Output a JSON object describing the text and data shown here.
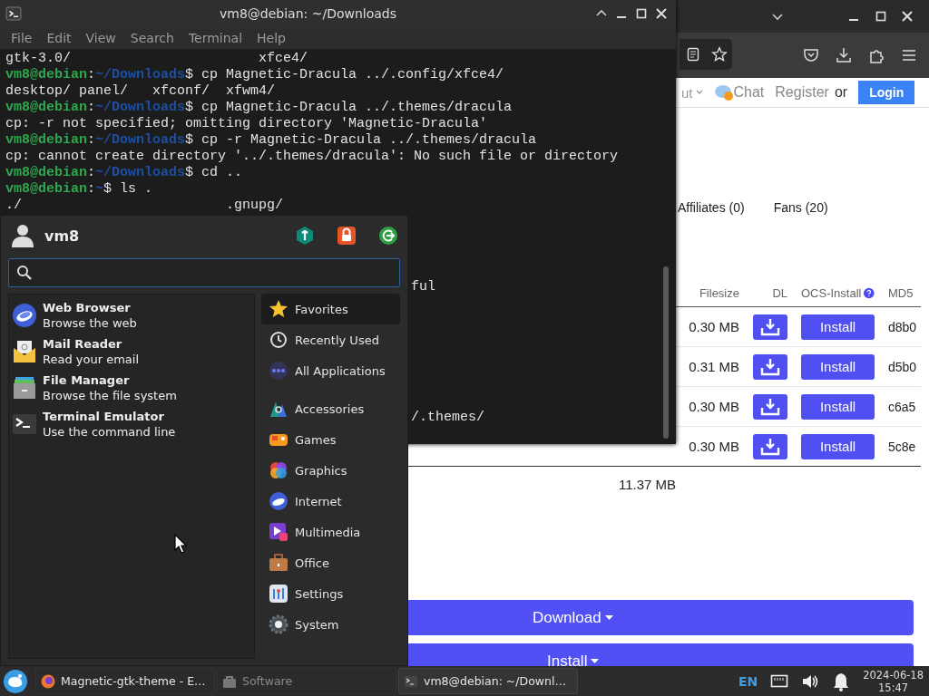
{
  "terminal": {
    "title": "vm8@debian: ~/Downloads",
    "menu": [
      "File",
      "Edit",
      "View",
      "Search",
      "Terminal",
      "Help"
    ],
    "lines": [
      {
        "kind": "output",
        "text": "gtk-3.0/                       xfce4/"
      },
      {
        "kind": "prompt",
        "user": "vm8@debian",
        "sep": ":",
        "path": "~/Downloads",
        "command": "$ cp Magnetic-Dracula ../.config/xfce4/"
      },
      {
        "kind": "output",
        "text": "desktop/ panel/   xfconf/  xfwm4/"
      },
      {
        "kind": "prompt",
        "user": "vm8@debian",
        "sep": ":",
        "path": "~/Downloads",
        "command": "$ cp Magnetic-Dracula ../.themes/dracula"
      },
      {
        "kind": "output",
        "text": "cp: -r not specified; omitting directory 'Magnetic-Dracula'"
      },
      {
        "kind": "prompt",
        "user": "vm8@debian",
        "sep": ":",
        "path": "~/Downloads",
        "command": "$ cp -r Magnetic-Dracula ../.themes/dracula"
      },
      {
        "kind": "output",
        "text": "cp: cannot create directory '../.themes/dracula': No such file or directory"
      },
      {
        "kind": "prompt",
        "user": "vm8@debian",
        "sep": ":",
        "path": "~/Downloads",
        "command": "$ cd .."
      },
      {
        "kind": "prompt",
        "user": "vm8@debian",
        "sep": ":",
        "path": "~",
        "command": "$ ls ."
      },
      {
        "kind": "output",
        "text": "./                         .gnupg/"
      },
      {
        "kind": "fragment",
        "text": "ful"
      },
      {
        "kind": "fragment",
        "text": "/.themes/"
      }
    ]
  },
  "browser": {
    "nav": [
      {
        "kind": "dropdown",
        "label": "ut"
      },
      {
        "kind": "chat",
        "label": "Chat"
      },
      {
        "kind": "link",
        "label": "Register"
      },
      {
        "kind": "text",
        "label": "or"
      },
      {
        "kind": "button",
        "label": "Login"
      }
    ],
    "tabs": [
      "Affiliates (0)",
      "Fans (20)"
    ],
    "table": {
      "columns": [
        "Filesize",
        "DL",
        "OCS-Install",
        "MD5"
      ],
      "rows": [
        {
          "filesize": "0.30 MB",
          "install": "Install",
          "md5": "d8b0"
        },
        {
          "filesize": "0.31 MB",
          "install": "Install",
          "md5": "d5b0"
        },
        {
          "filesize": "0.30 MB",
          "install": "Install",
          "md5": "c6a5"
        },
        {
          "filesize": "0.30 MB",
          "install": "Install",
          "md5": "5c8e"
        }
      ],
      "total": "11.37 MB"
    },
    "actions": [
      "Download",
      "Install"
    ]
  },
  "menu": {
    "user": "vm8",
    "favorites": [
      {
        "name": "Web Browser",
        "description": "Browse the web"
      },
      {
        "name": "Mail Reader",
        "description": "Read your email"
      },
      {
        "name": "File Manager",
        "description": "Browse the file system"
      },
      {
        "name": "Terminal Emulator",
        "description": "Use the command line"
      }
    ],
    "views": [
      {
        "label": "Favorites",
        "selected": true
      },
      {
        "label": "Recently Used",
        "selected": false
      },
      {
        "label": "All Applications",
        "selected": false
      }
    ],
    "categories": [
      {
        "label": "Accessories",
        "selected": false
      },
      {
        "label": "Games",
        "selected": false
      },
      {
        "label": "Graphics",
        "selected": false
      },
      {
        "label": "Internet",
        "selected": false
      },
      {
        "label": "Multimedia",
        "selected": false
      },
      {
        "label": "Office",
        "selected": false
      },
      {
        "label": "Settings",
        "selected": false
      },
      {
        "label": "System",
        "selected": false
      }
    ]
  },
  "taskbar": {
    "tasks": [
      {
        "label": "Magnetic-gtk-theme - E…",
        "active": false,
        "dimmed": false
      },
      {
        "label": "Software",
        "active": false,
        "dimmed": true
      },
      {
        "label": "vm8@debian: ~/Downl…",
        "active": true,
        "dimmed": false
      }
    ],
    "language": "EN",
    "date": "2024-06-18",
    "time": "15:47"
  }
}
